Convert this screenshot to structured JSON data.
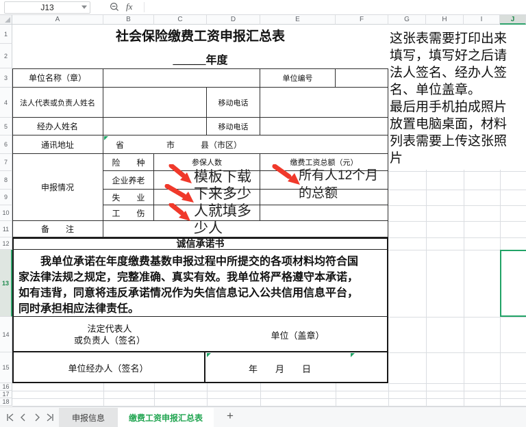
{
  "toolbar": {
    "name_box_value": "J13",
    "fx_label": "fx"
  },
  "grid": {
    "columns": [
      "A",
      "B",
      "C",
      "D",
      "E",
      "F",
      "G",
      "H",
      "I",
      "J"
    ],
    "rows": [
      "1",
      "2",
      "3",
      "4",
      "5",
      "6",
      "7",
      "8",
      "9",
      "10",
      "11",
      "12",
      "13",
      "14",
      "15",
      "16",
      "17",
      "18"
    ],
    "selected_cell": "J13",
    "selected_column": "J",
    "selected_row": "13"
  },
  "form": {
    "title": "社会保险缴费工资申报汇总表",
    "year_line": "______年度",
    "unit_name_label": "单位名称（章）",
    "unit_code_label": "单位编号",
    "legal_rep_label": "法人代表或负责人姓名",
    "mobile_label": "移动电话",
    "mobile_label_2": "移动电话",
    "agent_label": "经办人姓名",
    "address_label": "通讯地址",
    "province_label": "省",
    "city_label": "市",
    "county_label": "县（市区）",
    "declare_label": "申报情况",
    "insurance_col_label": "险　　种",
    "count_col_label": "参保人数",
    "wage_col_label": "缴费工资总额（元）",
    "pension_label": "企业养老",
    "unemploy_label": "失　　业",
    "injury_label": "工　　伤",
    "remark_label": "备　　注",
    "commitment_title": "诚信承诺书",
    "commitment_body": "　　我单位承诺在年度缴费基数申报过程中所提交的各项材料均符合国\n家法律法规之规定，完整准确、真实有效。我单位将严格遵守本承诺，\n如有违背，同意将违反承诺情况作为失信信息记入公共信用信息平台，\n同时承担相应法律责任。",
    "legal_sign_label": "法定代表人\n或负责人（签名）",
    "seal_label": "单位（盖章）",
    "agent_sign_label": "单位经办人（签名）",
    "date_label": "年　　月　　日"
  },
  "annotations": {
    "count_note": "模板下载\n下来多少\n人就填多\n少人",
    "wage_note": "所有人12个月\n的总额",
    "side_note": "这张表需要打印出来\n填写，填写好之后请\n法人签名、经办人签\n名、单位盖章。\n最后用手机拍成照片\n放置电脑桌面，材料\n列表需要上传这张照\n片"
  },
  "sheet_bar": {
    "tab_1": "申报信息",
    "tab_2": "缴费工资申报汇总表",
    "add_tab": "+"
  },
  "colors": {
    "accent_green": "#21a366",
    "arrow_red": "#f0392b",
    "active_tab_text": "#21a551"
  }
}
